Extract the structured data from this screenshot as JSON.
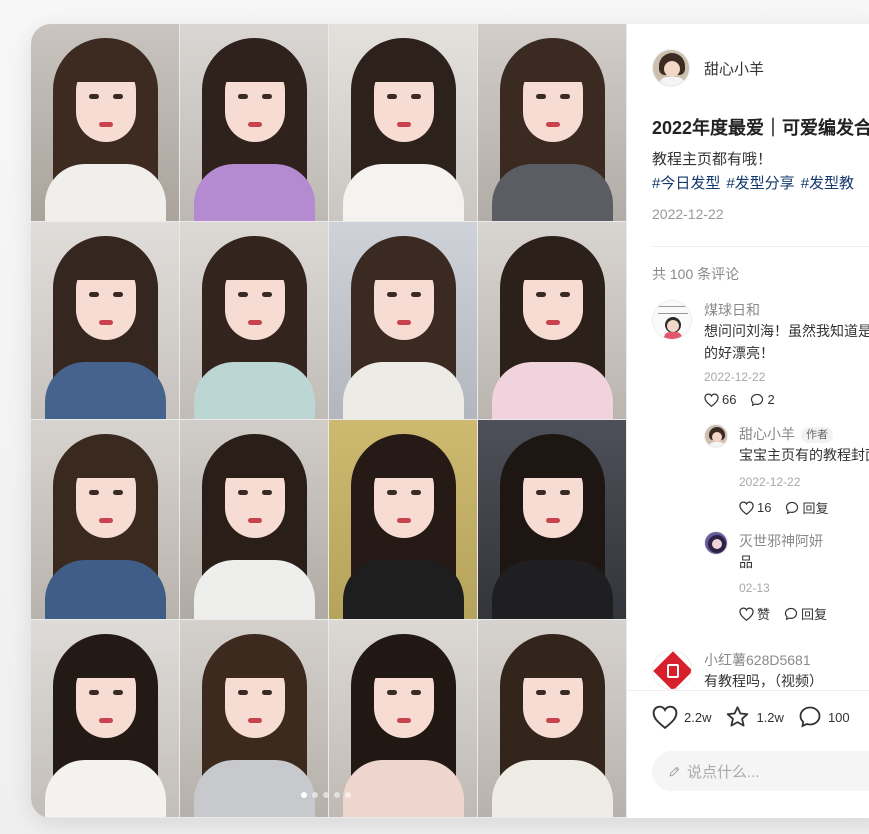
{
  "author": {
    "name": "甜心小羊",
    "avatar_icon": "user-avatar"
  },
  "note": {
    "title": "2022年度最爱｜可爱编发合",
    "desc": "教程主页都有哦！",
    "tags": [
      "#今日发型",
      "#发型分享",
      "#发型教"
    ],
    "date": "2022-12-22"
  },
  "comments_count_label": "共 100 条评论",
  "comments": [
    {
      "name": "煤球日和",
      "text_line1": "想问问刘海！虽然我知道是",
      "text_line2": "的好漂亮！",
      "date": "2022-12-22",
      "likes": "66",
      "replies": "2",
      "avatar_icon": "cartoon-avatar"
    },
    {
      "name": "甜心小羊",
      "badge": "作者",
      "text": "宝宝主页有的教程封面",
      "date": "2022-12-22",
      "likes": "16",
      "reply_label": "回复",
      "avatar_icon": "user-avatar"
    },
    {
      "name": "灭世邪神阿妍",
      "text": "品",
      "date": "02-13",
      "like_label": "赞",
      "reply_label": "回复",
      "avatar_icon": "anime-avatar"
    },
    {
      "name": "小红薯628D5681",
      "text": "有教程吗，（视频）",
      "avatar_icon": "red-stamp-avatar"
    }
  ],
  "engagement": {
    "likes": "2.2w",
    "collects": "1.2w",
    "comments": "100"
  },
  "input": {
    "placeholder": "说点什么..."
  },
  "carousel": {
    "total": 5,
    "current": 1
  },
  "colors": {
    "tag": "#13386c",
    "muted": "#8a8a8a",
    "accent": "#ff2442"
  }
}
